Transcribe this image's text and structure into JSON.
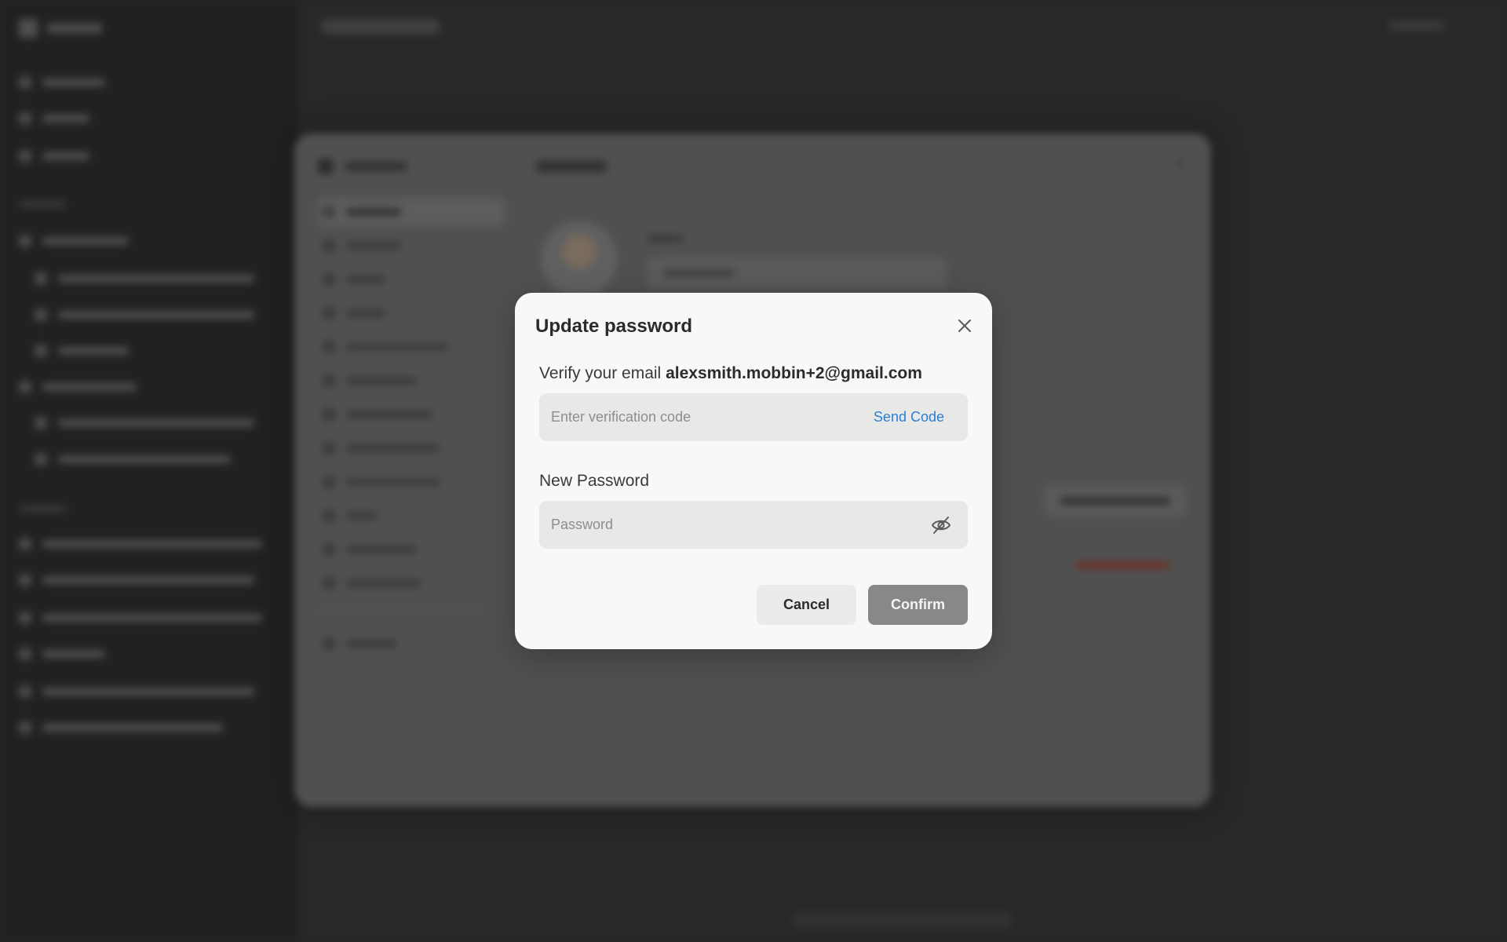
{
  "modal": {
    "title": "Update password",
    "verify_prefix": "Verify your email",
    "email": "alexsmith.mobbin+2@gmail.com",
    "verification_placeholder": "Enter verification code",
    "send_code_label": "Send Code",
    "new_password_label": "New Password",
    "password_placeholder": "Password",
    "cancel_label": "Cancel",
    "confirm_label": "Confirm"
  },
  "colors": {
    "accent_link": "#2a7fd4",
    "confirm_button": "#888888",
    "modal_background": "#f8f8f7",
    "input_background": "#e8e8e6"
  },
  "icons": [
    "close-icon",
    "eye-off-icon"
  ]
}
